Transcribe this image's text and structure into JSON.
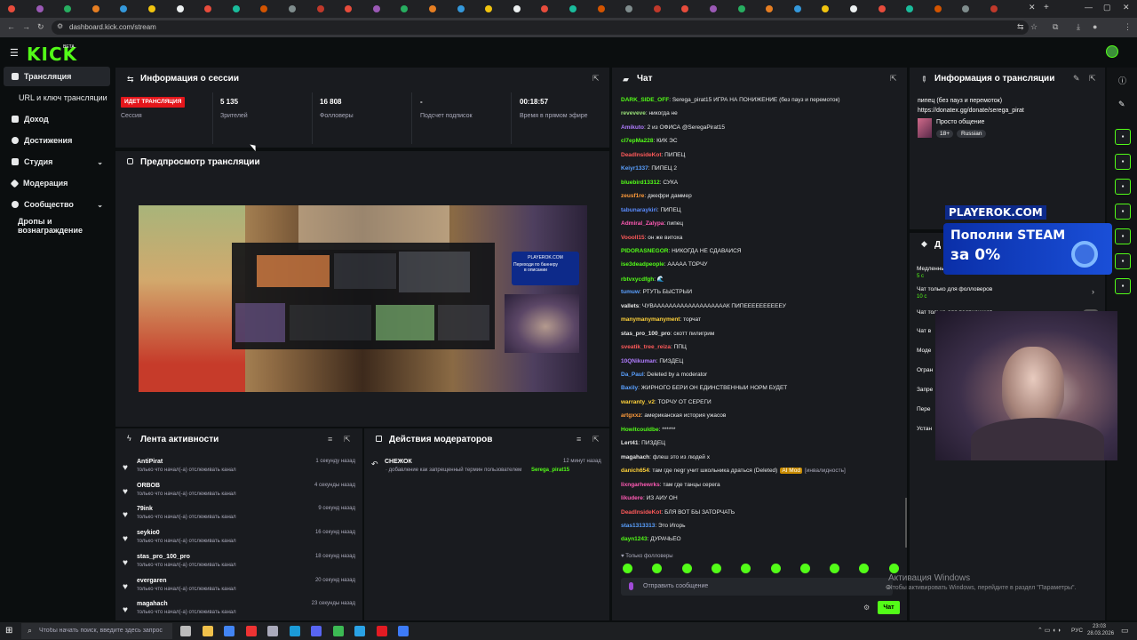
{
  "browser": {
    "url": "dashboard.kick.com/stream",
    "tab_count": 36
  },
  "app": {
    "logo": "KICK",
    "beta": "BETA"
  },
  "sidebar": {
    "items": [
      {
        "label": "Трансляция",
        "active": true
      },
      {
        "label": "URL и ключ трансляции"
      },
      {
        "label": "Доход"
      },
      {
        "label": "Достижения"
      },
      {
        "label": "Студия"
      },
      {
        "label": "Модерация"
      },
      {
        "label": "Сообщество"
      },
      {
        "label": "Дропы и вознаграждение"
      }
    ]
  },
  "session": {
    "title": "Информация о сессии",
    "live_badge": "ИДЕТ ТРАНСЛЯЦИЯ",
    "live_label": "Сессия",
    "viewers": "5 135",
    "viewers_label": "Зрителей",
    "followers": "16 808",
    "followers_label": "Фолловеры",
    "subs": "-",
    "subs_label": "Подсчет подписок",
    "uptime": "00:18:57",
    "uptime_label": "Время в прямом эфире"
  },
  "preview": {
    "title": "Предпросмотр трансляции",
    "overlay_brand": "PLAYEROK.COM",
    "overlay_text": "Переходи по баннеру в описании"
  },
  "activity": {
    "title": "Лента активности",
    "items": [
      {
        "name": "AntiPirat",
        "text": "только что начал(-а) отслеживать канал",
        "time": "1 секунду назад"
      },
      {
        "name": "ORBOB",
        "text": "только что начал(-а) отслеживать канал",
        "time": "4 секунды назад"
      },
      {
        "name": "79ink",
        "text": "только что начал(-а) отслеживать канал",
        "time": "9 секунд назад"
      },
      {
        "name": "seykio0",
        "text": "только что начал(-а) отслеживать канал",
        "time": "16 секунд назад"
      },
      {
        "name": "stas_pro_100_pro",
        "text": "только что начал(-а) отслеживать канал",
        "time": "18 секунд назад"
      },
      {
        "name": "evergaren",
        "text": "только что начал(-а) отслеживать канал",
        "time": "20 секунд назад"
      },
      {
        "name": "magahach",
        "text": "только что начал(-а) отслеживать канал",
        "time": "23 секунды назад"
      }
    ]
  },
  "mod_actions": {
    "title": "Действия модераторов",
    "item_name": "СНЕЖОК",
    "item_text": "· добавление как запрещенный термин пользователем",
    "item_user": "Serega_pirat15",
    "item_time": "12 минут назад"
  },
  "chat": {
    "title": "Чат",
    "messages": [
      {
        "user": "DARK_SIDE_OFF",
        "color": "#53fc18",
        "text": "Serega_pirat15 ИГРА НА ПОНИЖЕНИЕ (без пауз и перемоток)"
      },
      {
        "user": "reveveve",
        "color": "#9be37a",
        "text": "никогда не"
      },
      {
        "user": "Amikuto",
        "color": "#b07cff",
        "text": "2 из ОФИСА @SeregaPirat15"
      },
      {
        "user": "cl7epMa228",
        "color": "#53fc18",
        "text": "КИК ЭС"
      },
      {
        "user": "DeadInsideKot",
        "color": "#ff5a5a",
        "text": "ПИПЕЦ"
      },
      {
        "user": "Keiyr1337",
        "color": "#5aa0ff",
        "text": "ПИПЕЦ 2"
      },
      {
        "user": "bluebird13312",
        "color": "#53fc18",
        "text": "СУКА"
      },
      {
        "user": "zeusf1re",
        "color": "#ff9b3a",
        "text": "джефри даммер"
      },
      {
        "user": "tabunaraykiri",
        "color": "#5a8cff",
        "text": "ПИПЕЦ"
      },
      {
        "user": "Admiral_Zalypa",
        "color": "#ff5ab4",
        "text": "пипец"
      },
      {
        "user": "Voooll15",
        "color": "#ff5a5a",
        "text": "он же витоха"
      },
      {
        "user": "PIDORASNEGOR",
        "color": "#53fc18",
        "text": "НИКОГДА НЕ СДАВАЙСЯ"
      },
      {
        "user": "ise3deadpeople",
        "color": "#53fc18",
        "text": "ААААА ТОРЧУ"
      },
      {
        "user": "rbtvxycdfgh",
        "color": "#53fc18",
        "text": "🌊"
      },
      {
        "user": "tumuw",
        "color": "#5aa0ff",
        "text": "РТУТЬ БЫСТРЫЙ"
      },
      {
        "user": "vallets",
        "color": "#e8e8e8",
        "text": "ЧУВАААААААААААААААААААК ПИПЕЕЕЕЕЕЕЕЕЕУ"
      },
      {
        "user": "manymanymanyment",
        "color": "#ffd23a",
        "text": "торчат"
      },
      {
        "user": "stas_pro_100_pro",
        "color": "#e8e8e8",
        "text": "скотт пилигрим"
      },
      {
        "user": "sveatik_tree_reiza",
        "color": "#ff5a5a",
        "text": "ППЦ"
      },
      {
        "user": "10QNikuman",
        "color": "#b07cff",
        "text": "ПИЗДЕЦ"
      },
      {
        "user": "Da_Paul",
        "color": "#5aa0ff",
        "text": "Deleted by a moderator"
      },
      {
        "user": "Baxily",
        "color": "#5aa0ff",
        "text": "ЖИРНОГО БЕРИ ОН ЕДИНСТВЕННЫЙ НОРМ БУДЕТ"
      },
      {
        "user": "warranty_v2",
        "color": "#ffd23a",
        "text": "ТОРЧУ ОТ СЕРЕГИ"
      },
      {
        "user": "artgxxz",
        "color": "#ff9b3a",
        "text": "американская история ужасов"
      },
      {
        "user": "Howitcouldbe",
        "color": "#53fc18",
        "text": "******"
      },
      {
        "user": "Lert41",
        "color": "#e8e8e8",
        "text": "ПИЗДЕЦ"
      },
      {
        "user": "magahach",
        "color": "#e8e8e8",
        "text": "флеш это из людей х"
      },
      {
        "user": "danich654",
        "color": "#ffd23a",
        "text": "там где negr учит школьника драться (Deleted)",
        "badge": "AI Mod",
        "tail": "[инвалидность]"
      },
      {
        "user": "lixngarhewrks",
        "color": "#ff5ab4",
        "text": "там где танцы серега"
      },
      {
        "user": "likudere",
        "color": "#ff5ab4",
        "text": "ИЗ АИУ ОН"
      },
      {
        "user": "DeadInsideKot",
        "color": "#ff5a5a",
        "text": "БЛЯ ВОТ БЫ ЗАТОРЧАТЬ"
      },
      {
        "user": "stas1313313",
        "color": "#5aa0ff",
        "text": "Это Игорь"
      },
      {
        "user": "dayn1243",
        "color": "#53fc18",
        "text": "ДУРАЧЬЁО"
      }
    ],
    "followers_only": "Только фолловеры",
    "placeholder": "Отправить сообщение",
    "send_button": "Чат"
  },
  "stream_info": {
    "title": "Информация о трансляции",
    "desc_line1": "пипец (без пауз и перемоток)",
    "desc_line2": "https://donatex.gg/donate/serega_pirat",
    "category": "Просто общение",
    "tag1": "18+",
    "tag2": "Russian"
  },
  "settings": {
    "title_partial": "Д",
    "slow_label": "Медленный",
    "slow_value": "5 с",
    "followers_chat": "Чат только для фолловеров",
    "followers_value": "10 с",
    "subs_chat": "Чат только для подписчиков",
    "rows": [
      "Чат в",
      "Моде",
      "Огран",
      "Запре",
      "Пере",
      "Устан"
    ]
  },
  "promo": {
    "brand": "PLAYEROK.COM",
    "line1": "Пополни STEAM",
    "line2": "за 0%"
  },
  "windows": {
    "activation_title": "Активация Windows",
    "activation_text": "Чтобы активировать Windows, перейдите в раздел \"Параметры\".",
    "search_placeholder": "Чтобы начать поиск, введите здесь запрос",
    "lang": "РУС",
    "time": "23:03",
    "date": "28.03.2026"
  }
}
